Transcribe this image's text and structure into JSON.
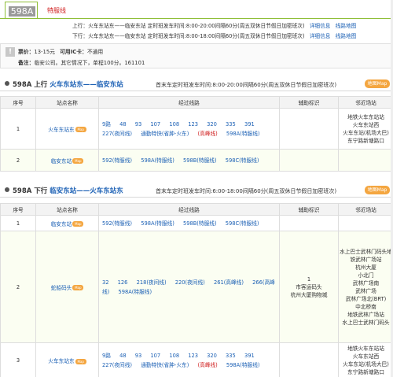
{
  "route": {
    "name": "598A",
    "type": "特服线",
    "up_label": "上行",
    "up_dir": "火车东站东——临安东站",
    "up_time": "定时班发车时间:8:00-20:00间隔60分(周五双休日节假日加密班次)",
    "down_label": "下行",
    "down_dir": "火车东站东——临安东站",
    "down_time": "定时班发车时间:8:00-18:00间隔60分(周五双休日节假日加密班次)",
    "detail_link": "详细信息",
    "map_link": "线路地图"
  },
  "notice": {
    "fare_label": "票价：",
    "fare": "13-15元",
    "ic_label": "可用IC卡：",
    "ic": "不通用",
    "remark_label": "备注：",
    "remark": "临安公司。其它情况下，单程100分。161101"
  },
  "columns": [
    "序号",
    "站点名称",
    "经过线路",
    "辅助标识",
    "邻近场站"
  ],
  "map_btn": "地图Map",
  "marker": "Map",
  "sections": [
    {
      "id": "598A",
      "dir": "上行",
      "name": "火车东站东——临安东站",
      "time": "首末车定时班发车时间:8:00-20:00间隔60分(周五双休日节假日加密班次)",
      "rows": [
        {
          "no": "1",
          "stop": "火车东站东",
          "lines": [
            {
              "t": "9路",
              "s": false
            },
            {
              "t": "48",
              "s": false
            },
            {
              "t": "93",
              "s": false
            },
            {
              "t": "107",
              "s": false
            },
            {
              "t": "108",
              "s": false
            },
            {
              "t": "123",
              "s": false
            },
            {
              "t": "320",
              "s": false
            },
            {
              "t": "335",
              "s": false
            },
            {
              "t": "391",
              "s": false
            },
            {
              "t": "227(夜间线)",
              "s": false
            },
            {
              "t": "通勤特快(省肿-火东)",
              "s": false
            },
            {
              "t": "(高峰线)",
              "s": true
            },
            {
              "t": "598A(特服线)",
              "s": false
            }
          ],
          "aux": "",
          "near": [
            "地铁火车东站站",
            "火车东站西",
            "火车东站(机场大巴)",
            "东宁路新塘路口"
          ]
        },
        {
          "no": "2",
          "stop": "临安东站",
          "lines": [
            {
              "t": "592(特服线)",
              "s": false
            },
            {
              "t": "598A(特服线)",
              "s": false
            },
            {
              "t": "598B(特服线)",
              "s": false
            },
            {
              "t": "598C(特服线)",
              "s": false
            }
          ],
          "aux": "",
          "near": []
        }
      ]
    },
    {
      "id": "598A",
      "dir": "下行",
      "name": "临安东站——火车东站东",
      "time": "首末车定时班发车时间:6:00-18:00间隔60分(周五双休日节假日加密班次)",
      "rows": [
        {
          "no": "1",
          "stop": "临安东站",
          "lines": [
            {
              "t": "592(特服线)",
              "s": false
            },
            {
              "t": "598A(特服线)",
              "s": false
            },
            {
              "t": "598B(特服线)",
              "s": false
            },
            {
              "t": "598C(特服线)",
              "s": false
            }
          ],
          "aux": "",
          "near": []
        },
        {
          "no": "2",
          "stop": "蛇船码头",
          "lines": [
            {
              "t": "32",
              "s": false
            },
            {
              "t": "126",
              "s": false
            },
            {
              "t": "218(夜间线)",
              "s": false
            },
            {
              "t": "220(夜间线)",
              "s": false
            },
            {
              "t": "261(高峰线)",
              "s": false
            },
            {
              "t": "266(高峰线)",
              "s": false
            },
            {
              "t": "598A(特服线)",
              "s": false
            }
          ],
          "aux": "1\n市客运码头\n杭州大厦购物城",
          "near": [
            "水上巴士武林门码头地",
            "铁武林广场站",
            "杭州大厦",
            "小北门",
            "武林广场南",
            "武林广场",
            "武林广场北(BRT)",
            "中北桥南",
            "地铁武林广场站",
            "水上巴士武林门码头"
          ]
        },
        {
          "no": "3",
          "stop": "火车东站东",
          "lines": [
            {
              "t": "9路",
              "s": false
            },
            {
              "t": "48",
              "s": false
            },
            {
              "t": "93",
              "s": false
            },
            {
              "t": "107",
              "s": false
            },
            {
              "t": "108",
              "s": false
            },
            {
              "t": "123",
              "s": false
            },
            {
              "t": "320",
              "s": false
            },
            {
              "t": "335",
              "s": false
            },
            {
              "t": "391",
              "s": false
            },
            {
              "t": "227(夜间线)",
              "s": false
            },
            {
              "t": "通勤特快(省肿-火东)",
              "s": false
            },
            {
              "t": "(高峰线)",
              "s": true
            },
            {
              "t": "598A(特服线)",
              "s": false
            }
          ],
          "aux": "",
          "near": [
            "地铁火车东站站",
            "火车东站西",
            "火车东站(机场大巴)",
            "东宁路新塘路口"
          ]
        }
      ]
    }
  ]
}
